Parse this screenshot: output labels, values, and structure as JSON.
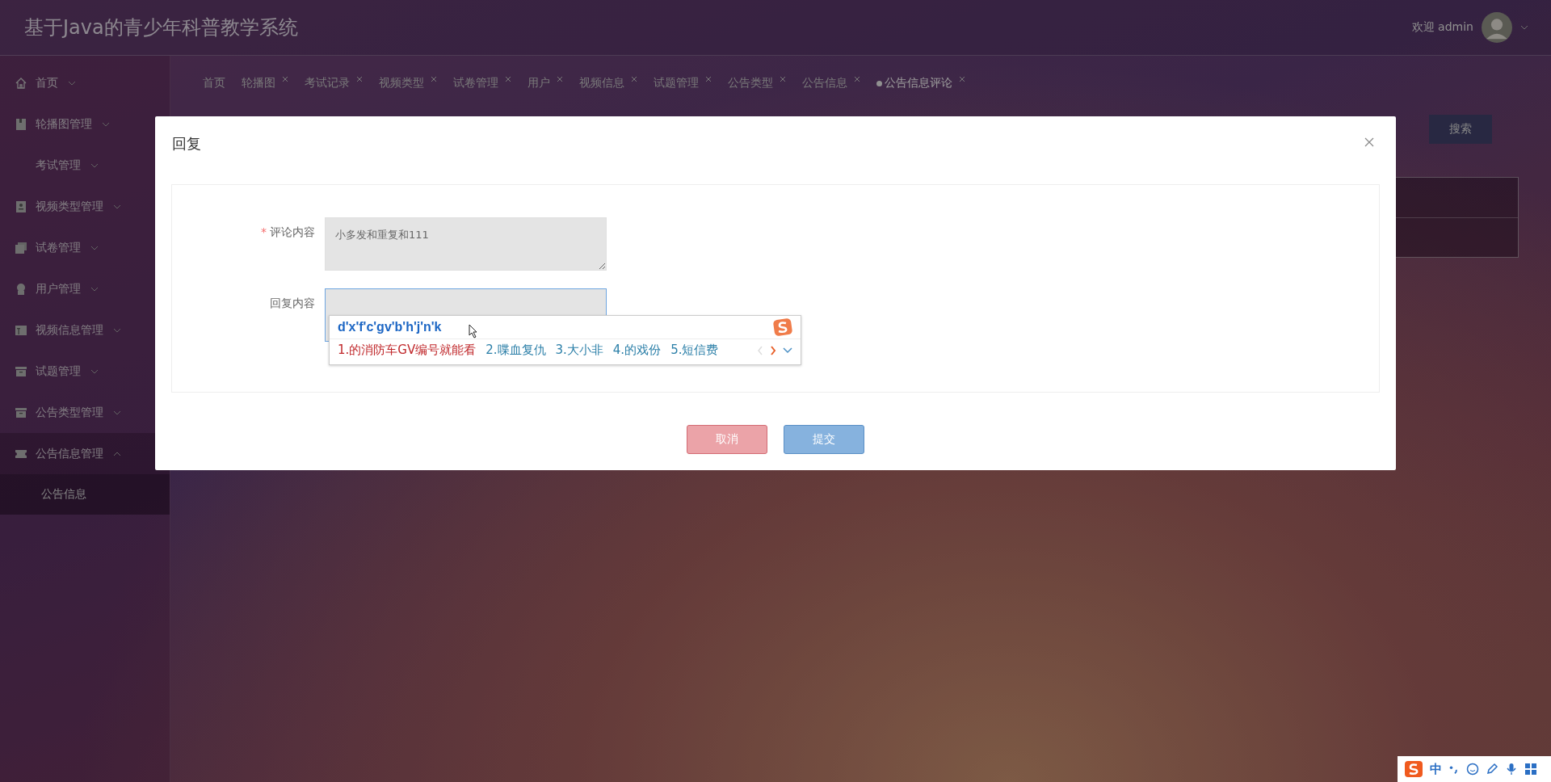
{
  "header": {
    "title": "基于Java的青少年科普教学系统",
    "welcome": "欢迎 admin"
  },
  "sidebar": {
    "items": [
      {
        "label": "首页",
        "expanded": false
      },
      {
        "label": "轮播图管理",
        "expanded": false
      },
      {
        "label": "考试管理",
        "expanded": false
      },
      {
        "label": "视频类型管理",
        "expanded": false
      },
      {
        "label": "试卷管理",
        "expanded": false
      },
      {
        "label": "用户管理",
        "expanded": false
      },
      {
        "label": "视频信息管理",
        "expanded": false
      },
      {
        "label": "试题管理",
        "expanded": false
      },
      {
        "label": "公告类型管理",
        "expanded": false
      },
      {
        "label": "公告信息管理",
        "expanded": true,
        "children": [
          {
            "label": "公告信息"
          }
        ]
      }
    ]
  },
  "tabs": [
    {
      "label": "首页",
      "closable": false,
      "selected": false
    },
    {
      "label": "轮播图",
      "closable": true,
      "selected": false
    },
    {
      "label": "考试记录",
      "closable": true,
      "selected": false
    },
    {
      "label": "视频类型",
      "closable": true,
      "selected": false
    },
    {
      "label": "试卷管理",
      "closable": true,
      "selected": false
    },
    {
      "label": "用户",
      "closable": true,
      "selected": false
    },
    {
      "label": "视频信息",
      "closable": true,
      "selected": false
    },
    {
      "label": "试题管理",
      "closable": true,
      "selected": false
    },
    {
      "label": "公告类型",
      "closable": true,
      "selected": false
    },
    {
      "label": "公告信息",
      "closable": true,
      "selected": false
    },
    {
      "label": "公告信息评论",
      "closable": true,
      "selected": true
    }
  ],
  "search_button": "搜索",
  "dialog": {
    "title": "回复",
    "fields": [
      {
        "label": "评论内容",
        "required_mark": "*",
        "value": "小多发和重复和111",
        "focused": false
      },
      {
        "label": "回复内容",
        "focused": true
      }
    ],
    "buttons": [
      {
        "label": "取消",
        "kind": "cancel"
      },
      {
        "label": "提交",
        "kind": "submit"
      }
    ]
  },
  "ime_popup": {
    "composition": "d'x'f'c'gv'b'h'j'n'k",
    "candidates": [
      {
        "label": "1.的消防车GV编号就能看",
        "selected": true
      },
      {
        "label": "2.喋血复仇",
        "selected": false
      },
      {
        "label": "3.大小非",
        "selected": false
      },
      {
        "label": "4.的戏份",
        "selected": false
      },
      {
        "label": "5.短信费",
        "selected": false
      }
    ]
  },
  "ime_toolbar": {
    "mode": "中"
  }
}
